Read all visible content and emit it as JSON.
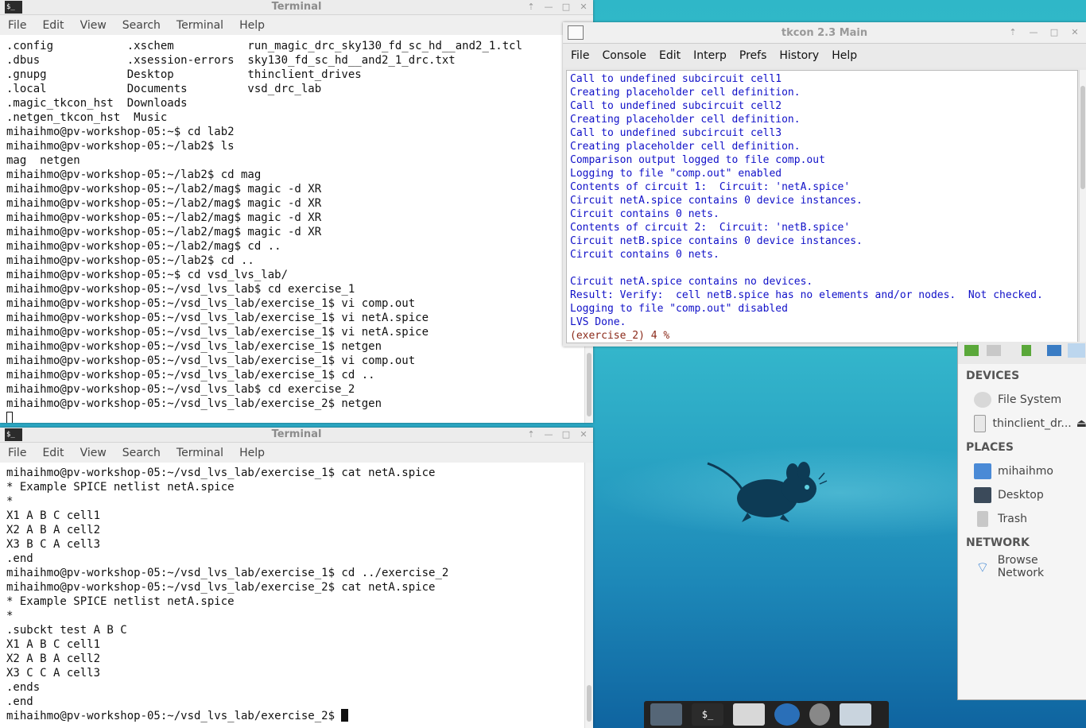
{
  "term1": {
    "title": "Terminal",
    "menu": [
      "File",
      "Edit",
      "View",
      "Search",
      "Terminal",
      "Help"
    ],
    "lines": [
      ".config           .xschem           run_magic_drc_sky130_fd_sc_hd__and2_1.tcl",
      ".dbus             .xsession-errors  sky130_fd_sc_hd__and2_1_drc.txt",
      ".gnupg            Desktop           thinclient_drives",
      ".local            Documents         vsd_drc_lab",
      ".magic_tkcon_hst  Downloads",
      ".netgen_tkcon_hst  Music",
      "mihaihmo@pv-workshop-05:~$ cd lab2",
      "mihaihmo@pv-workshop-05:~/lab2$ ls",
      "mag  netgen",
      "mihaihmo@pv-workshop-05:~/lab2$ cd mag",
      "mihaihmo@pv-workshop-05:~/lab2/mag$ magic -d XR",
      "mihaihmo@pv-workshop-05:~/lab2/mag$ magic -d XR",
      "mihaihmo@pv-workshop-05:~/lab2/mag$ magic -d XR",
      "mihaihmo@pv-workshop-05:~/lab2/mag$ magic -d XR",
      "mihaihmo@pv-workshop-05:~/lab2/mag$ cd ..",
      "mihaihmo@pv-workshop-05:~/lab2$ cd ..",
      "mihaihmo@pv-workshop-05:~$ cd vsd_lvs_lab/",
      "mihaihmo@pv-workshop-05:~/vsd_lvs_lab$ cd exercise_1",
      "mihaihmo@pv-workshop-05:~/vsd_lvs_lab/exercise_1$ vi comp.out",
      "mihaihmo@pv-workshop-05:~/vsd_lvs_lab/exercise_1$ vi netA.spice",
      "mihaihmo@pv-workshop-05:~/vsd_lvs_lab/exercise_1$ vi netA.spice",
      "mihaihmo@pv-workshop-05:~/vsd_lvs_lab/exercise_1$ netgen",
      "mihaihmo@pv-workshop-05:~/vsd_lvs_lab/exercise_1$ vi comp.out",
      "mihaihmo@pv-workshop-05:~/vsd_lvs_lab/exercise_1$ cd ..",
      "mihaihmo@pv-workshop-05:~/vsd_lvs_lab$ cd exercise_2",
      "mihaihmo@pv-workshop-05:~/vsd_lvs_lab/exercise_2$ netgen"
    ]
  },
  "term2": {
    "title": "Terminal",
    "menu": [
      "File",
      "Edit",
      "View",
      "Search",
      "Terminal",
      "Help"
    ],
    "lines": [
      "mihaihmo@pv-workshop-05:~/vsd_lvs_lab/exercise_1$ cat netA.spice",
      "* Example SPICE netlist netA.spice",
      "*",
      "X1 A B C cell1",
      "X2 A B A cell2",
      "X3 B C A cell3",
      ".end",
      "mihaihmo@pv-workshop-05:~/vsd_lvs_lab/exercise_1$ cd ../exercise_2",
      "mihaihmo@pv-workshop-05:~/vsd_lvs_lab/exercise_2$ cat netA.spice",
      "* Example SPICE netlist netA.spice",
      "*",
      ".subckt test A B C",
      "X1 A B C cell1",
      "X2 A B A cell2",
      "X3 C C A cell3",
      ".ends",
      ".end",
      "mihaihmo@pv-workshop-05:~/vsd_lvs_lab/exercise_2$ "
    ]
  },
  "tkcon": {
    "title": "tkcon 2.3 Main",
    "menu": [
      "File",
      "Console",
      "Edit",
      "Interp",
      "Prefs",
      "History",
      "Help"
    ],
    "lines": [
      "Call to undefined subcircuit cell1",
      "Creating placeholder cell definition.",
      "Call to undefined subcircuit cell2",
      "Creating placeholder cell definition.",
      "Call to undefined subcircuit cell3",
      "Creating placeholder cell definition.",
      "Comparison output logged to file comp.out",
      "Logging to file \"comp.out\" enabled",
      "Contents of circuit 1:  Circuit: 'netA.spice'",
      "Circuit netA.spice contains 0 device instances.",
      "Circuit contains 0 nets.",
      "Contents of circuit 2:  Circuit: 'netB.spice'",
      "Circuit netB.spice contains 0 device instances.",
      "Circuit contains 0 nets.",
      "",
      "Circuit netA.spice contains no devices.",
      "Result: Verify:  cell netB.spice has no elements and/or nodes.  Not checked.",
      "Logging to file \"comp.out\" disabled",
      "LVS Done."
    ],
    "prompt": "(exercise_2) 4 %"
  },
  "filemanager": {
    "devices_header": "DEVICES",
    "devices": [
      "File System",
      "thinclient_dr..."
    ],
    "places_header": "PLACES",
    "places": [
      "mihaihmo",
      "Desktop",
      "Trash"
    ],
    "network_header": "NETWORK",
    "network": [
      "Browse Network"
    ]
  }
}
